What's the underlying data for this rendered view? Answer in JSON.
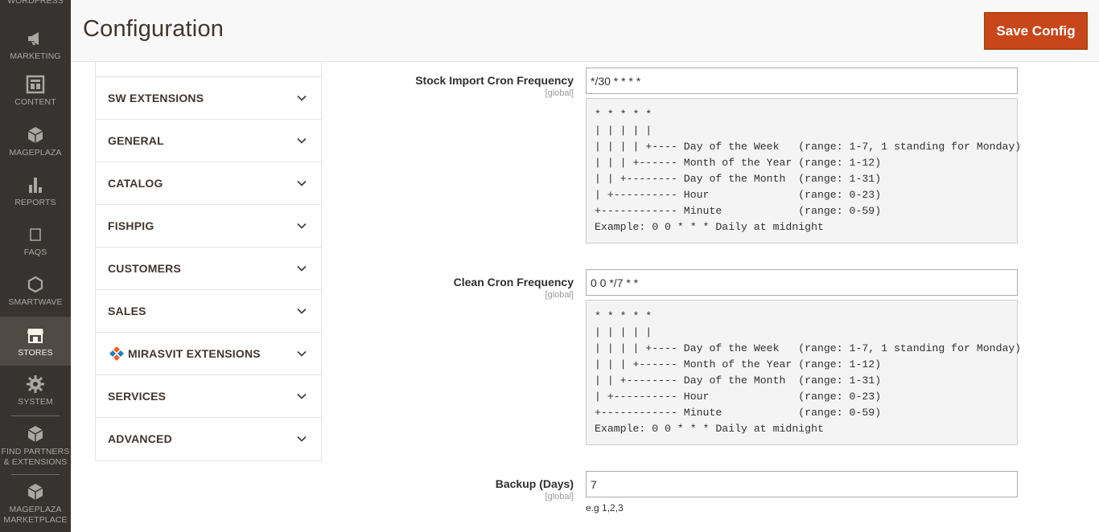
{
  "menu": {
    "items": [
      {
        "label": "WORDPRESS",
        "icon": "wordpress-icon"
      },
      {
        "label": "MARKETING",
        "icon": "megaphone-icon"
      },
      {
        "label": "CONTENT",
        "icon": "content-layout-icon"
      },
      {
        "label": "MAGEPLAZA",
        "icon": "mageplaza-box-icon"
      },
      {
        "label": "REPORTS",
        "icon": "bar-chart-icon"
      },
      {
        "label": "FAQS",
        "icon": "faq-square-icon"
      },
      {
        "label": "SMARTWAVE",
        "icon": "hexagon-icon"
      },
      {
        "label": "STORES",
        "icon": "storefront-icon"
      },
      {
        "label": "SYSTEM",
        "icon": "gear-icon"
      },
      {
        "label_line1": "FIND PARTNERS",
        "label_line2": "& EXTENSIONS",
        "icon": "partners-box-icon"
      },
      {
        "label_line1": "MAGEPLAZA",
        "label_line2": "MARKETPLACE",
        "icon": "marketplace-box-icon"
      }
    ]
  },
  "header": {
    "title": "Configuration",
    "save_label": "Save Config"
  },
  "tabs": [
    {
      "label": "SW EXTENSIONS"
    },
    {
      "label": "GENERAL"
    },
    {
      "label": "CATALOG"
    },
    {
      "label": "FISHPIG"
    },
    {
      "label": "CUSTOMERS"
    },
    {
      "label": "SALES"
    },
    {
      "label": "MIRASVIT EXTENSIONS"
    },
    {
      "label": "SERVICES"
    },
    {
      "label": "ADVANCED"
    }
  ],
  "fields": {
    "stock_cron": {
      "label": "Stock Import Cron Frequency",
      "scope": "[global]",
      "value": "*/30 * * * *",
      "note": "* * * * *\n| | | | |\n| | | | +---- Day of the Week   (range: 1-7, 1 standing for Monday)\n| | | +------ Month of the Year (range: 1-12)\n| | +-------- Day of the Month  (range: 1-31)\n| +---------- Hour              (range: 0-23)\n+------------ Minute            (range: 0-59)\nExample: 0 0 * * * Daily at midnight"
    },
    "clean_cron": {
      "label": "Clean Cron Frequency",
      "scope": "[global]",
      "value": "0 0 */7 * *",
      "note": "* * * * *\n| | | | |\n| | | | +---- Day of the Week   (range: 1-7, 1 standing for Monday)\n| | | +------ Month of the Year (range: 1-12)\n| | +-------- Day of the Month  (range: 1-31)\n| +---------- Hour              (range: 0-23)\n+------------ Minute            (range: 0-59)\nExample: 0 0 * * * Daily at midnight"
    },
    "backup": {
      "label": "Backup (Days)",
      "scope": "[global]",
      "value": "7",
      "hint": "e.g 1,2,3"
    }
  },
  "colors": {
    "menu_bg": "#373330",
    "menu_active_bg": "#514943",
    "save_button": "#c8471a"
  }
}
